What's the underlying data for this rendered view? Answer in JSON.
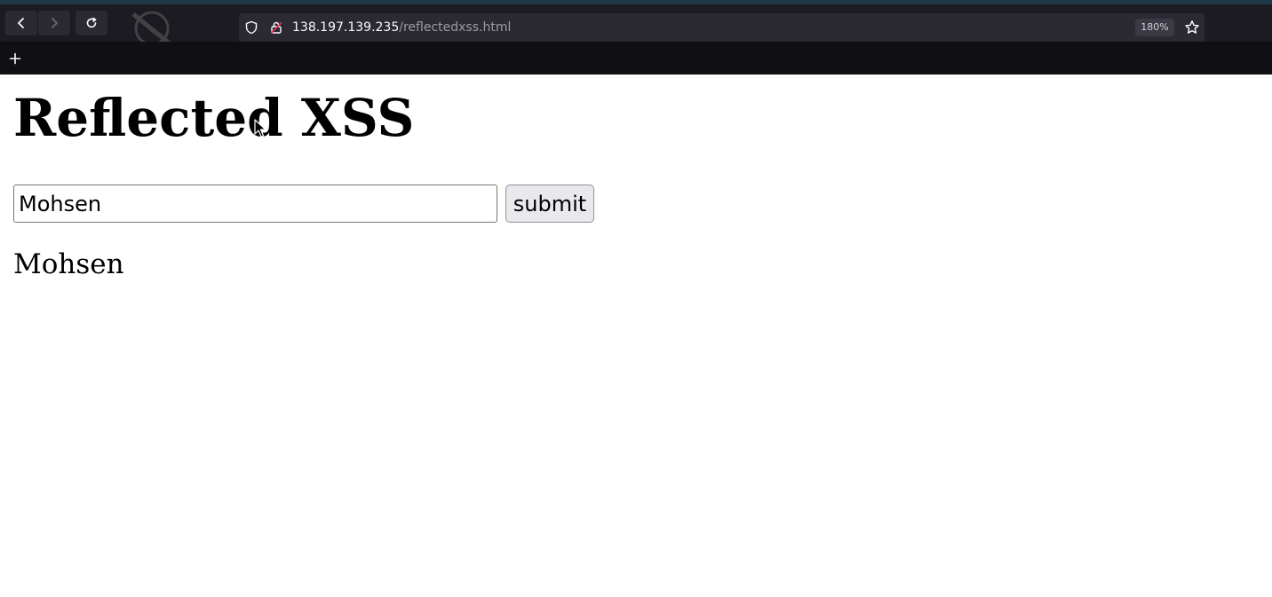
{
  "browser": {
    "url": {
      "host": "138.197.139.235",
      "path": "/reflectedxss.html"
    },
    "zoom": "180%",
    "icons": [
      "back-icon",
      "forward-icon",
      "reload-icon",
      "shield-icon",
      "lock-icon",
      "star-icon",
      "new-tab-icon"
    ]
  },
  "page": {
    "heading": "Reflected XSS",
    "input": {
      "value": "Mohsen"
    },
    "submit_label": "submit",
    "reflected_output": "Mohsen"
  },
  "colors": {
    "toolbar": "#1c1b22",
    "tabbar": "#0f0f14",
    "button": "#e9e9ed"
  }
}
